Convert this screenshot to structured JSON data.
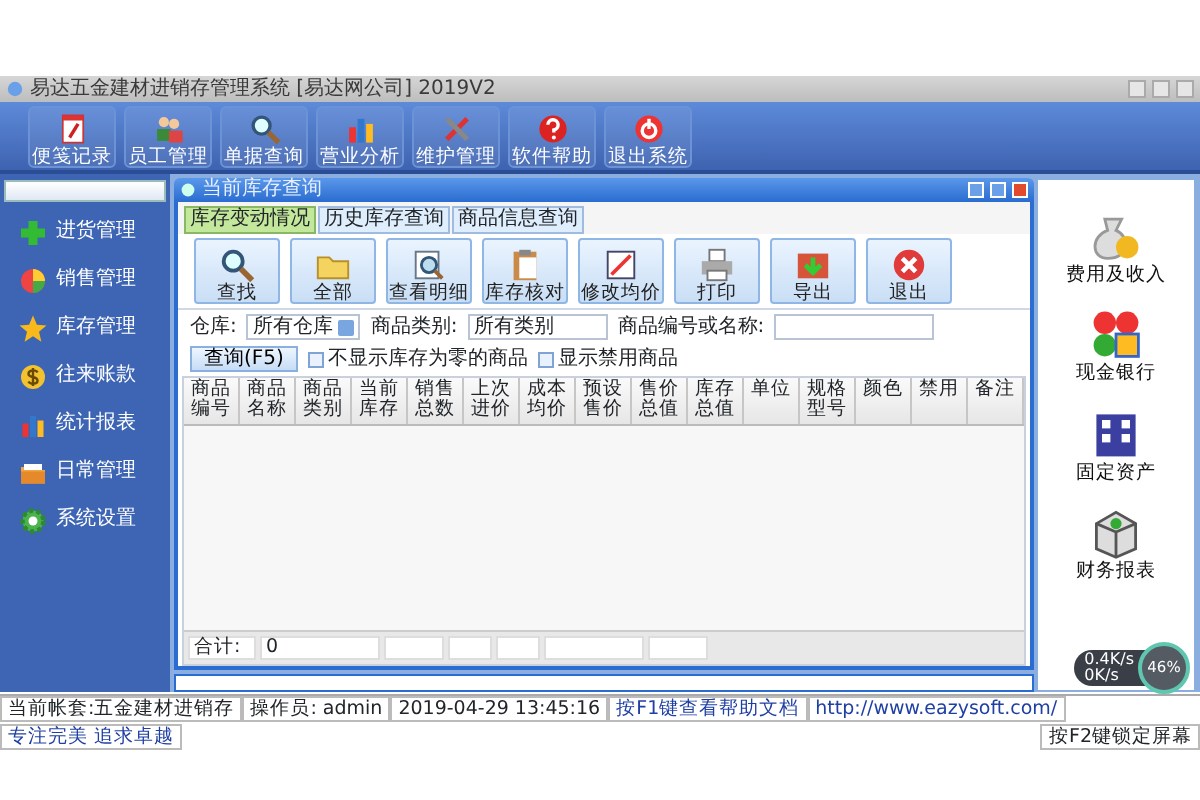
{
  "window": {
    "title": "易达五金建材进销存管理系统 [易达网公司] 2019V2"
  },
  "menu_bar": [
    "便笺记录",
    "员工管理",
    "单据查询",
    "营业分析",
    "维护管理",
    "软件帮助",
    "退出系统"
  ],
  "sidebar": {
    "items": [
      "进货管理",
      "销售管理",
      "库存管理",
      "往来账款",
      "统计报表",
      "日常管理",
      "系统设置"
    ]
  },
  "child_window": {
    "title": "当前库存查询",
    "tabs": [
      {
        "label": "库存变动情况",
        "selected": true
      },
      {
        "label": "历史库存查询",
        "selected": false
      },
      {
        "label": "商品信息查询",
        "selected": false
      }
    ],
    "toolbar": [
      "查找",
      "全部",
      "查看明细",
      "库存核对",
      "修改均价",
      "打印",
      "导出",
      "退出"
    ],
    "filters": {
      "warehouse_label": "仓库:",
      "warehouse_value": "所有仓库",
      "category_label": "商品类别:",
      "category_value": "所有类别",
      "code_label": "商品编号或名称:",
      "query_button": "查询(F5)",
      "options": [
        {
          "label": "不显示库存为零的商品",
          "checked": false
        },
        {
          "label": "显示禁用商品",
          "checked": false
        }
      ]
    },
    "table": {
      "columns": [
        "商品编号",
        "商品名称",
        "商品类别",
        "当前库存",
        "销售总数",
        "上次进价",
        "成本均价",
        "预设售价",
        "售价总值",
        "库存总值",
        "单位",
        "规格型号",
        "颜色",
        "禁用",
        "备注"
      ],
      "footer": [
        "合计:",
        "0"
      ]
    }
  },
  "right_panel": {
    "items": [
      "费用及收入",
      "现金银行",
      "固定资产",
      "财务报表"
    ]
  },
  "network_widget": {
    "upload": "0.4K/s",
    "download": "0K/s",
    "percent": "46%"
  },
  "status_bar": [
    "当前帐套:五金建材进销存",
    "操作员: admin",
    "2019-04-29 13:45:16",
    "按F1键查看帮助文档",
    "http://www.eazysoft.com/",
    "专注完美 追求卓越",
    "按F2键锁定屏幕"
  ]
}
